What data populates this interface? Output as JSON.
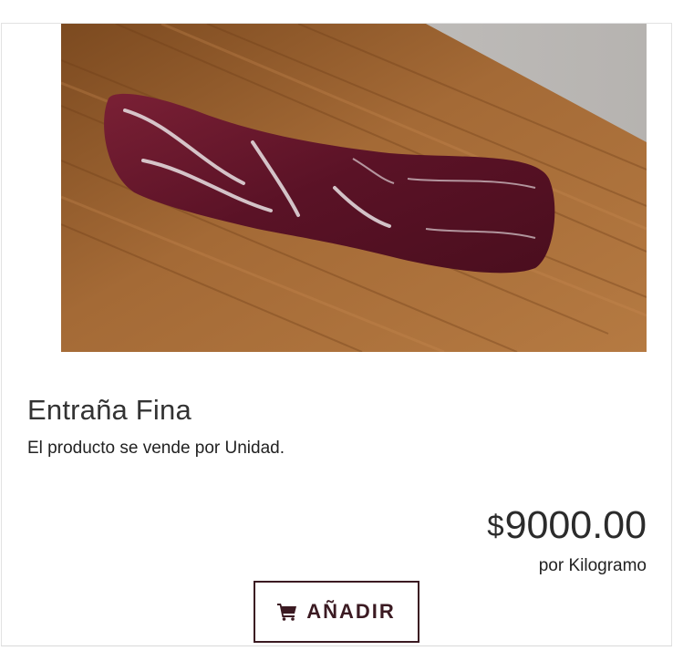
{
  "product": {
    "image_alt": "Entraña Fina",
    "title": "Entraña Fina",
    "subtitle": "El producto se vende por Unidad.",
    "currency": "$",
    "price": "9000.00",
    "unit_label": "por Kilogramo",
    "add_button": {
      "label": "AÑADIR",
      "icon": "cart-icon"
    }
  },
  "colors": {
    "accent": "#3b1a22",
    "board": "#9a6534",
    "meat": "#5e1428"
  }
}
